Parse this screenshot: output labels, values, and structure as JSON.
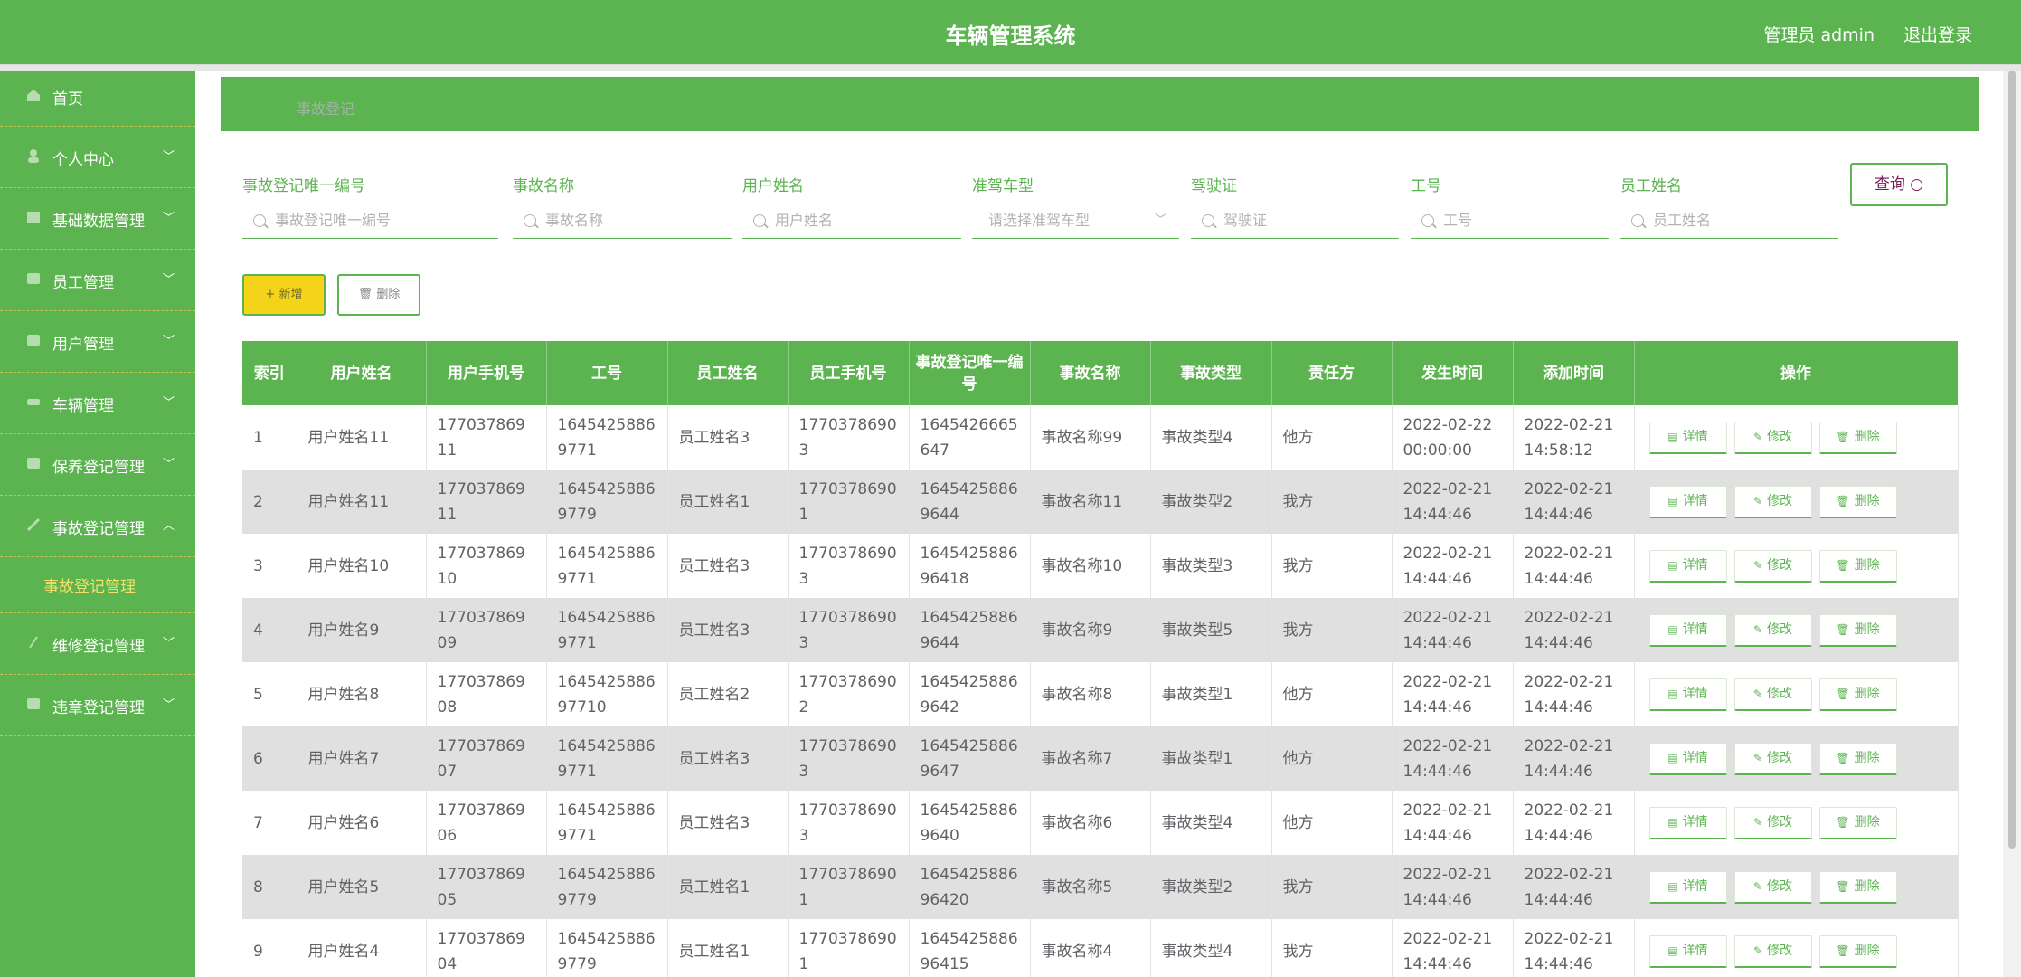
{
  "header": {
    "title": "车辆管理系统",
    "user": "管理员 admin",
    "logout": "退出登录"
  },
  "sidebar": {
    "items": [
      {
        "label": "首页",
        "icon": "home-icon"
      },
      {
        "label": "个人中心",
        "icon": "person-icon"
      },
      {
        "label": "基础数据管理",
        "icon": "data-icon"
      },
      {
        "label": "员工管理",
        "icon": "staff-icon"
      },
      {
        "label": "用户管理",
        "icon": "user-icon"
      },
      {
        "label": "车辆管理",
        "icon": "car-icon"
      },
      {
        "label": "保养登记管理",
        "icon": "maintenance-icon"
      },
      {
        "label": "事故登记管理",
        "icon": "accident-icon"
      },
      {
        "label": "维修登记管理",
        "icon": "repair-icon"
      },
      {
        "label": "违章登记管理",
        "icon": "violation-icon"
      }
    ],
    "submenu_active": "事故登记管理"
  },
  "breadcrumb": "事故登记",
  "filters": {
    "f1": {
      "label": "事故登记唯一编号",
      "placeholder": "事故登记唯一编号"
    },
    "f2": {
      "label": "事故名称",
      "placeholder": "事故名称"
    },
    "f3": {
      "label": "用户姓名",
      "placeholder": "用户姓名"
    },
    "f4": {
      "label": "准驾车型",
      "placeholder": "请选择准驾车型"
    },
    "f5": {
      "label": "驾驶证",
      "placeholder": "驾驶证"
    },
    "f6": {
      "label": "工号",
      "placeholder": "工号"
    },
    "f7": {
      "label": "员工姓名",
      "placeholder": "员工姓名"
    }
  },
  "buttons": {
    "query": "查询",
    "add": "新增",
    "delete": "删除"
  },
  "table": {
    "columns": [
      "索引",
      "用户姓名",
      "用户手机号",
      "工号",
      "员工姓名",
      "员工手机号",
      "事故登记唯一编号",
      "事故名称",
      "事故类型",
      "责任方",
      "发生时间",
      "添加时间",
      "操作"
    ],
    "rows": [
      [
        "1",
        "用户姓名11",
        "17703786911",
        "16454258869771",
        "员工姓名3",
        "17703786903",
        "1645426665647",
        "事故名称99",
        "事故类型4",
        "他方",
        "2022-02-22 00:00:00",
        "2022-02-21 14:58:12"
      ],
      [
        "2",
        "用户姓名11",
        "17703786911",
        "16454258869779",
        "员工姓名1",
        "17703786901",
        "16454258869644",
        "事故名称11",
        "事故类型2",
        "我方",
        "2022-02-21 14:44:46",
        "2022-02-21 14:44:46"
      ],
      [
        "3",
        "用户姓名10",
        "17703786910",
        "16454258869771",
        "员工姓名3",
        "17703786903",
        "164542588696418",
        "事故名称10",
        "事故类型3",
        "我方",
        "2022-02-21 14:44:46",
        "2022-02-21 14:44:46"
      ],
      [
        "4",
        "用户姓名9",
        "17703786909",
        "16454258869771",
        "员工姓名3",
        "17703786903",
        "16454258869644",
        "事故名称9",
        "事故类型5",
        "我方",
        "2022-02-21 14:44:46",
        "2022-02-21 14:44:46"
      ],
      [
        "5",
        "用户姓名8",
        "17703786908",
        "164542588697710",
        "员工姓名2",
        "17703786902",
        "16454258869642",
        "事故名称8",
        "事故类型1",
        "他方",
        "2022-02-21 14:44:46",
        "2022-02-21 14:44:46"
      ],
      [
        "6",
        "用户姓名7",
        "17703786907",
        "16454258869771",
        "员工姓名3",
        "17703786903",
        "16454258869647",
        "事故名称7",
        "事故类型1",
        "他方",
        "2022-02-21 14:44:46",
        "2022-02-21 14:44:46"
      ],
      [
        "7",
        "用户姓名6",
        "17703786906",
        "16454258869771",
        "员工姓名3",
        "17703786903",
        "16454258869640",
        "事故名称6",
        "事故类型4",
        "他方",
        "2022-02-21 14:44:46",
        "2022-02-21 14:44:46"
      ],
      [
        "8",
        "用户姓名5",
        "17703786905",
        "16454258869779",
        "员工姓名1",
        "17703786901",
        "164542588696420",
        "事故名称5",
        "事故类型2",
        "我方",
        "2022-02-21 14:44:46",
        "2022-02-21 14:44:46"
      ],
      [
        "9",
        "用户姓名4",
        "17703786904",
        "16454258869779",
        "员工姓名1",
        "17703786901",
        "164542588696415",
        "事故名称4",
        "事故类型4",
        "我方",
        "2022-02-21 14:44:46",
        "2022-02-21 14:44:46"
      ]
    ],
    "actions": {
      "detail": "详情",
      "edit": "修改",
      "delete": "删除"
    }
  },
  "colors": {
    "primary": "#5bb450",
    "accent": "#f4d41a",
    "submenu": "#f5e16a"
  }
}
